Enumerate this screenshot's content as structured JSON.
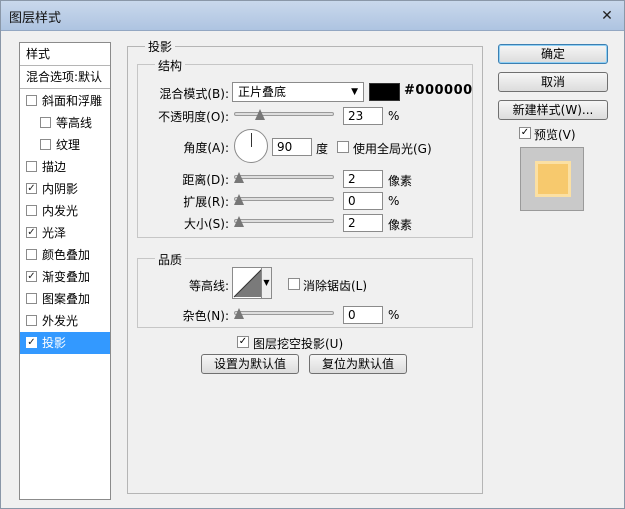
{
  "window": {
    "title": "图层样式",
    "close": "✕"
  },
  "left": {
    "header": "样式",
    "blend_options": "混合选项:默认",
    "items": [
      {
        "label": "斜面和浮雕",
        "checked": false
      },
      {
        "label": "等高线",
        "checked": false
      },
      {
        "label": "纹理",
        "checked": false
      },
      {
        "label": "描边",
        "checked": false
      },
      {
        "label": "内阴影",
        "checked": true
      },
      {
        "label": "内发光",
        "checked": false
      },
      {
        "label": "光泽",
        "checked": true
      },
      {
        "label": "颜色叠加",
        "checked": false
      },
      {
        "label": "渐变叠加",
        "checked": true
      },
      {
        "label": "图案叠加",
        "checked": false
      },
      {
        "label": "外发光",
        "checked": false
      },
      {
        "label": "投影",
        "checked": true
      }
    ]
  },
  "panel": {
    "title": "投影",
    "structure": {
      "title": "结构",
      "blend_mode_label": "混合模式(B):",
      "blend_mode_value": "正片叠底",
      "color_hex": "#000000",
      "opacity_label": "不透明度(O):",
      "opacity_value": "23",
      "opacity_unit": "%",
      "opacity_fraction": 0.23,
      "angle_label": "角度(A):",
      "angle_value": "90",
      "angle_unit": "度",
      "global_light_label": "使用全局光(G)",
      "distance_label": "距离(D):",
      "distance_value": "2",
      "distance_unit": "像素",
      "spread_label": "扩展(R):",
      "spread_value": "0",
      "spread_unit": "%",
      "size_label": "大小(S):",
      "size_value": "2",
      "size_unit": "像素"
    },
    "quality": {
      "title": "品质",
      "contour_label": "等高线:",
      "antialias_label": "消除锯齿(L)",
      "noise_label": "杂色(N):",
      "noise_value": "0",
      "noise_unit": "%"
    },
    "knockout_label": "图层挖空投影(U)",
    "make_default": "设置为默认值",
    "reset_default": "复位为默认值"
  },
  "buttons": {
    "ok": "确定",
    "cancel": "取消",
    "new_style": "新建样式(W)...",
    "preview_label": "预览(V)"
  },
  "icons": {
    "checkbox_check": "✓",
    "dropdown": "▼"
  },
  "colors": {
    "selection": "#3399ff",
    "preview_fill": "#f7c96d"
  }
}
